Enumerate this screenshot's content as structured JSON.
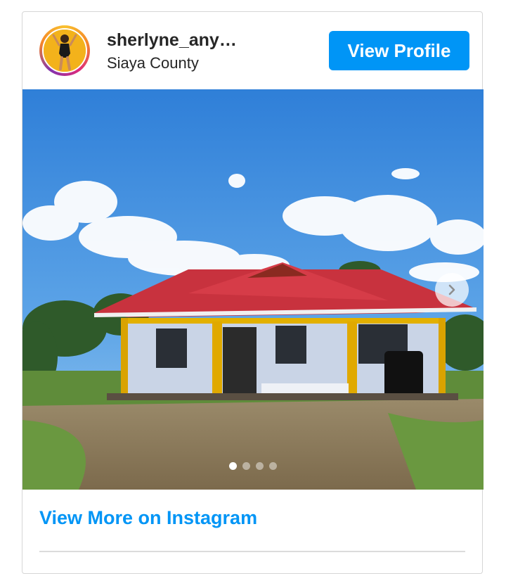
{
  "profile": {
    "username": "sherlyne_any…",
    "location": "Siaya County",
    "avatar_icon": "profile-avatar",
    "view_profile_label": "View Profile"
  },
  "post": {
    "image_subject": "photo-house",
    "next_icon": "chevron-right-icon",
    "slide_count": 4,
    "active_slide": 1
  },
  "footer": {
    "more_label": "View More on Instagram"
  },
  "colors": {
    "accent": "#0095f6",
    "text": "#262626",
    "border": "#d6d6d6"
  }
}
